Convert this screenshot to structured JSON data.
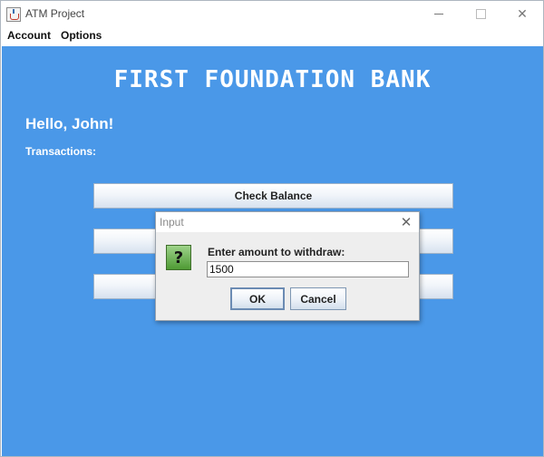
{
  "window": {
    "title": "ATM Project",
    "icon": "java-icon"
  },
  "menubar": {
    "items": [
      "Account",
      "Options"
    ]
  },
  "main": {
    "bank_name": "FIRST FOUNDATION BANK",
    "greeting": "Hello, John!",
    "transactions_label": "Transactions:",
    "buttons": [
      "Check Balance",
      "",
      ""
    ],
    "background_color": "#4a98e8"
  },
  "dialog": {
    "title": "Input",
    "icon": "question-icon",
    "prompt": "Enter amount to withdraw:",
    "input_value": "1500",
    "ok_label": "OK",
    "cancel_label": "Cancel"
  }
}
